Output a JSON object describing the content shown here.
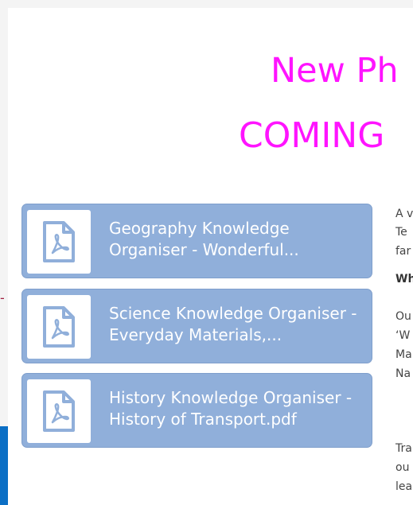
{
  "heading": {
    "line1": "New Ph",
    "line2": "COMING"
  },
  "files": [
    {
      "name": "Geography Knowledge Organiser - Wonderful...",
      "icon": "pdf-file-icon"
    },
    {
      "name": "Science Knowledge Organiser - Everyday Materials,...",
      "icon": "pdf-file-icon"
    },
    {
      "name": "History Knowledge Organiser - History of Transport.pdf",
      "icon": "pdf-file-icon"
    }
  ],
  "right_text": {
    "lines": [
      "A v",
      "Te",
      "far",
      "Wh",
      "Ou",
      "‘W",
      "Ma",
      "Na",
      "Tra",
      "ou",
      "lea"
    ]
  },
  "left_edge": {
    "mark": "-"
  },
  "colors": {
    "heading": "#ff14ff",
    "card": "#90afda",
    "left_bar": "#0b6fc5"
  }
}
